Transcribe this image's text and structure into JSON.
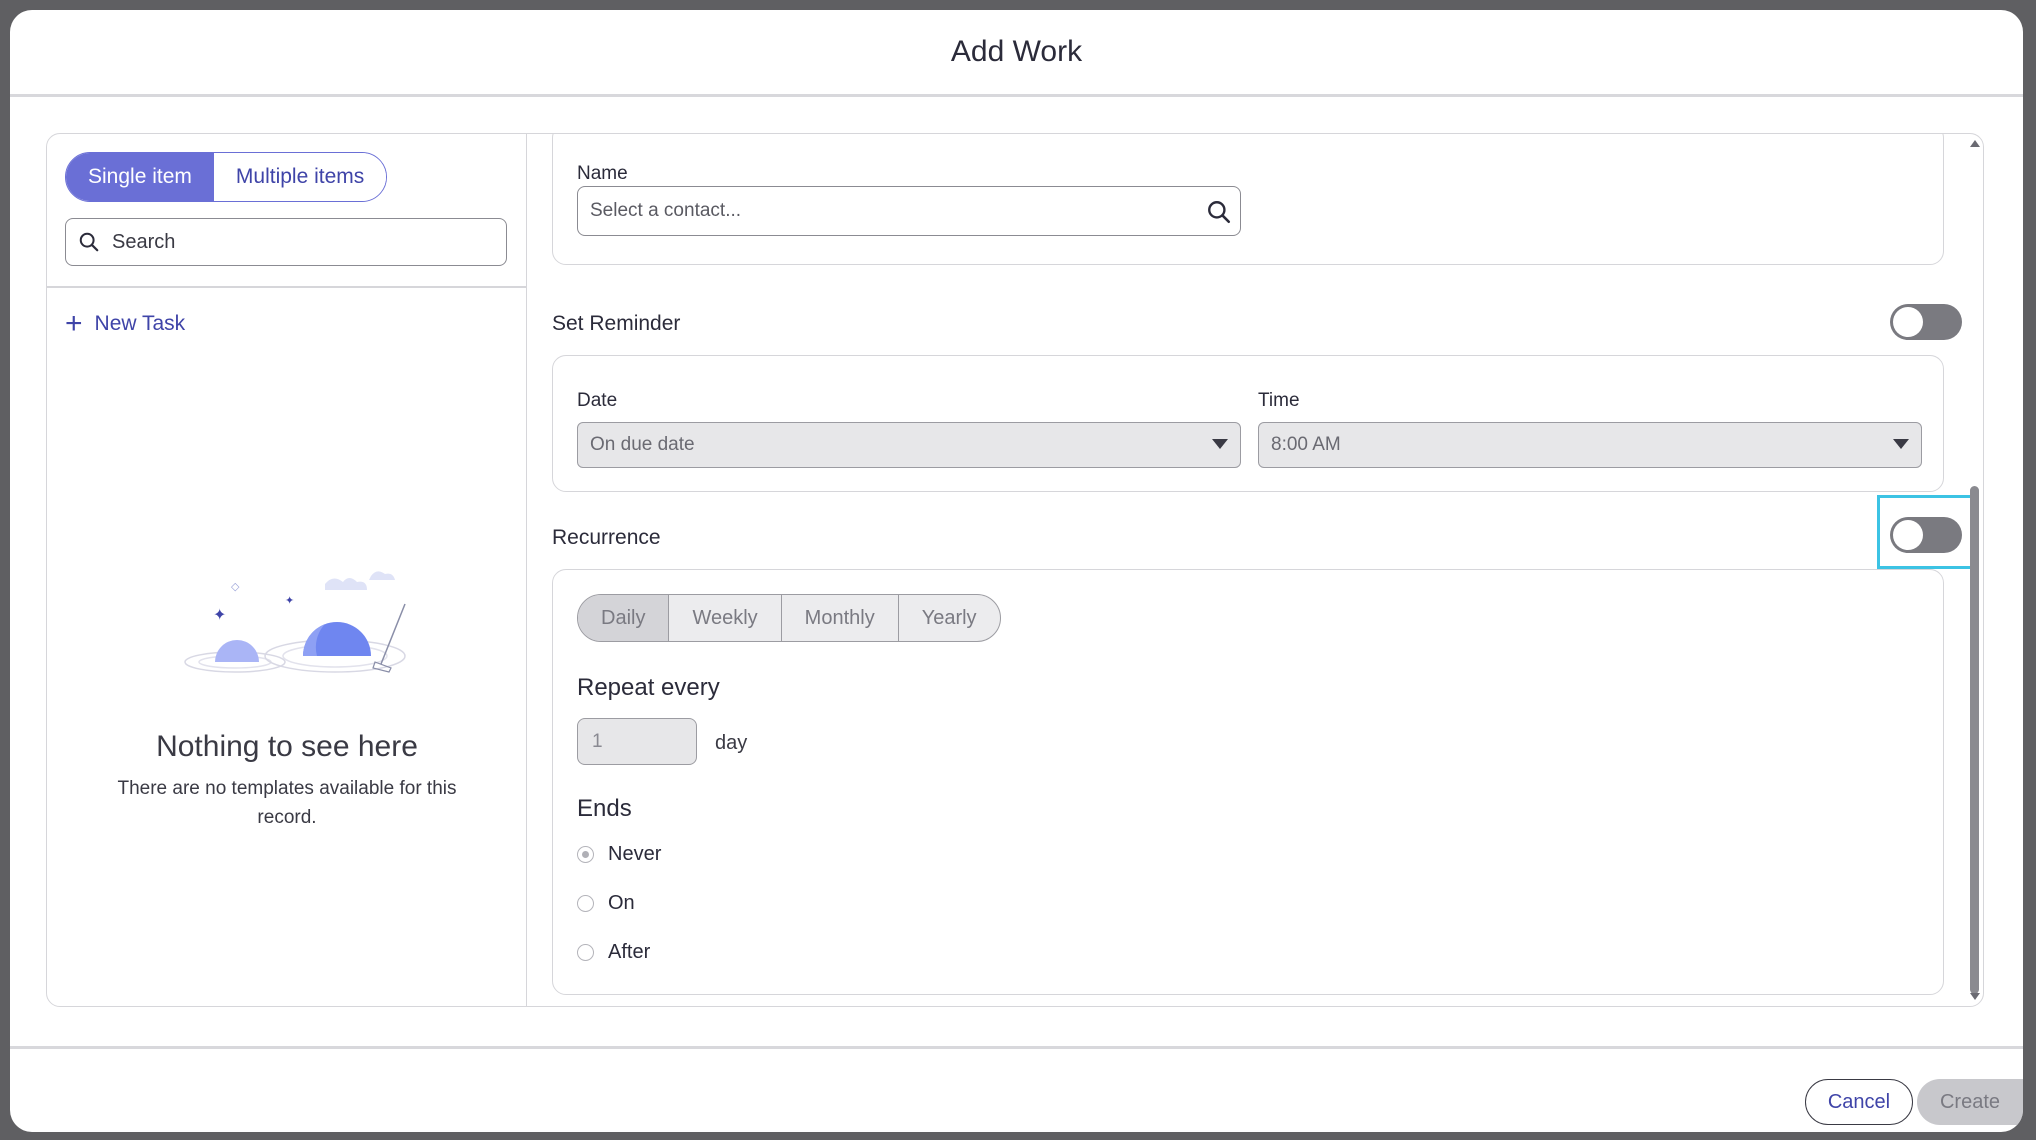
{
  "dialog": {
    "title": "Add Work"
  },
  "left_pane": {
    "mode_tabs": [
      {
        "label": "Single item",
        "active": true
      },
      {
        "label": "Multiple items",
        "active": false
      }
    ],
    "search": {
      "placeholder": "Search",
      "value": ""
    },
    "new_task_label": "New Task",
    "empty_state": {
      "title": "Nothing to see here",
      "text": "There are no templates available for this record."
    }
  },
  "form": {
    "name": {
      "label": "Name",
      "placeholder": "Select a contact..."
    },
    "reminder": {
      "label": "Set Reminder",
      "enabled": false,
      "date_label": "Date",
      "date_value": "On due date",
      "time_label": "Time",
      "time_value": "8:00 AM"
    },
    "recurrence": {
      "label": "Recurrence",
      "enabled": false,
      "frequencies": [
        {
          "label": "Daily",
          "active": true
        },
        {
          "label": "Weekly",
          "active": false
        },
        {
          "label": "Monthly",
          "active": false
        },
        {
          "label": "Yearly",
          "active": false
        }
      ],
      "repeat_every_label": "Repeat every",
      "repeat_every_value": "1",
      "repeat_unit": "day",
      "ends_label": "Ends",
      "ends_options": [
        {
          "label": "Never",
          "checked": true
        },
        {
          "label": "On",
          "checked": false
        },
        {
          "label": "After",
          "checked": false
        }
      ]
    }
  },
  "footer": {
    "cancel_label": "Cancel",
    "create_label": "Create"
  },
  "colors": {
    "accent": "#6a6fd6",
    "link": "#3f44a8",
    "highlight": "#3cc3e4",
    "toggle_off": "#7a7a80"
  },
  "icons": [
    "search-icon",
    "plus-icon",
    "caret-down-icon",
    "empty-state-illustration"
  ]
}
